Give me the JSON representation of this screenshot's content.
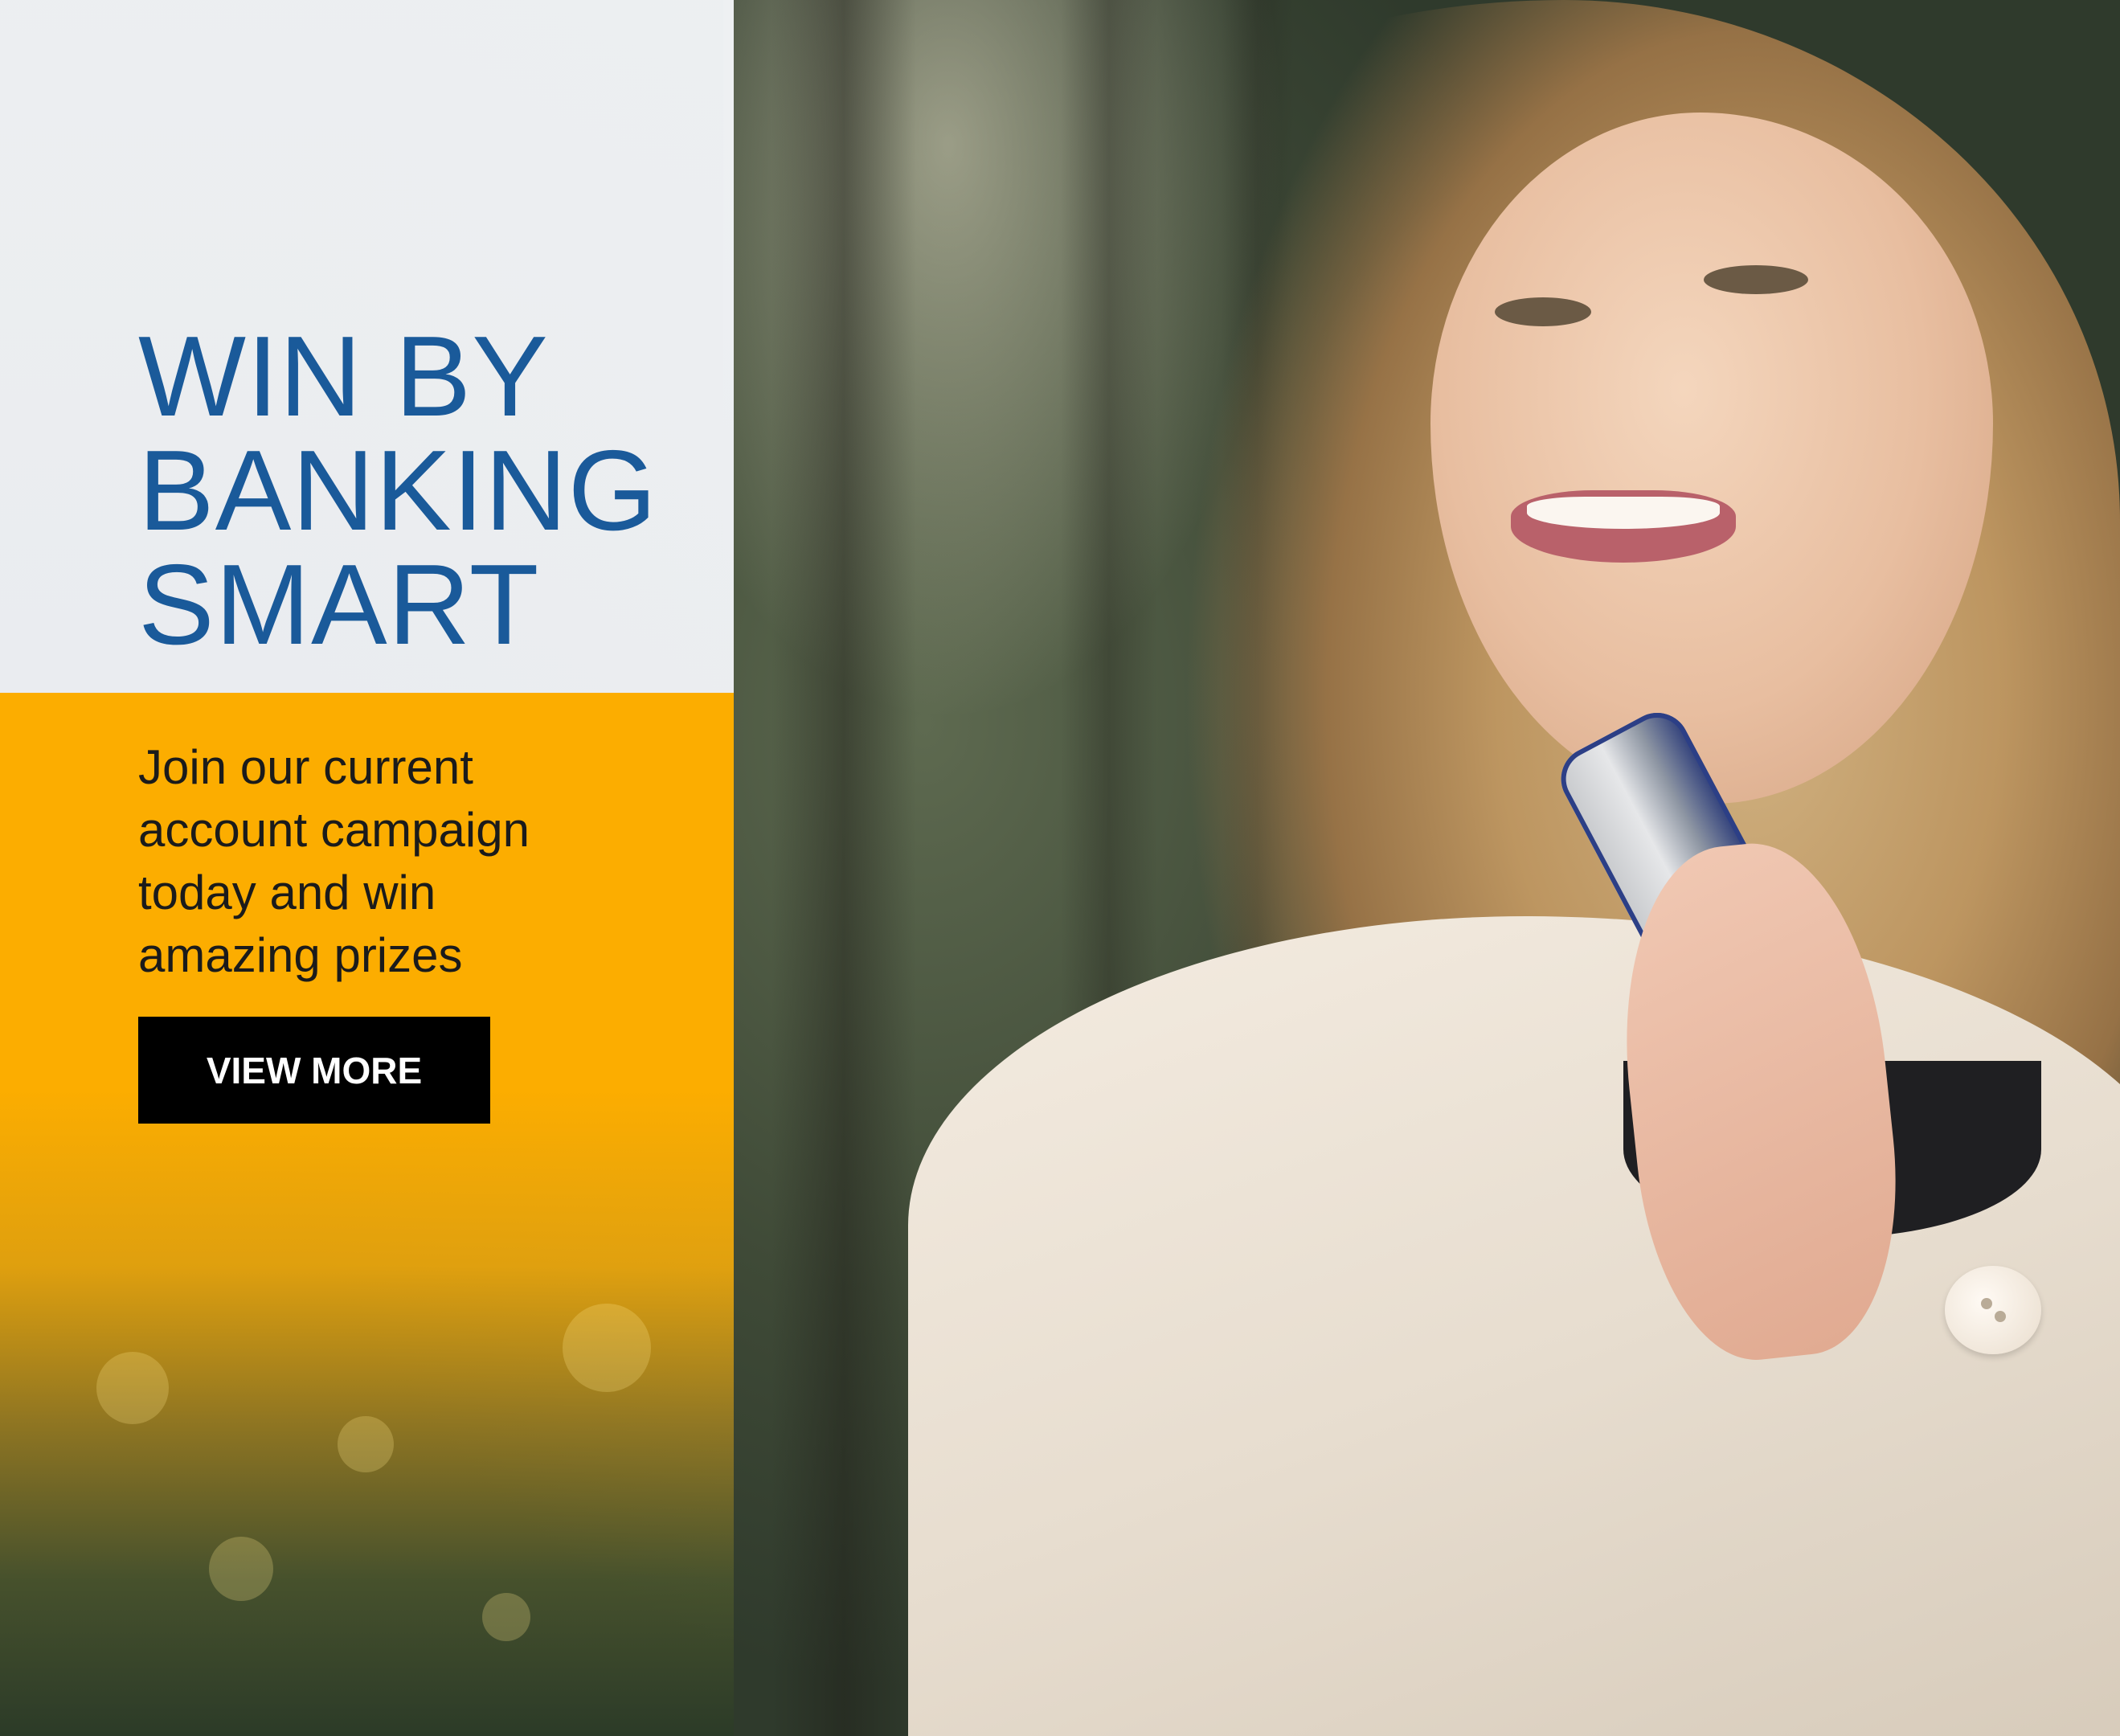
{
  "banner": {
    "headline": [
      "WIN BY",
      "BANKING",
      "SMART"
    ],
    "subtext": [
      "Join our current",
      "account campaign",
      "today and win",
      "amazing prizes"
    ],
    "cta_label": "VIEW MORE"
  },
  "colors": {
    "headline": "#1a5a9a",
    "accent_panel": "#fcad00",
    "light_panel": "#f2f4f7",
    "cta_background": "#000000",
    "cta_text": "#ffffff"
  }
}
